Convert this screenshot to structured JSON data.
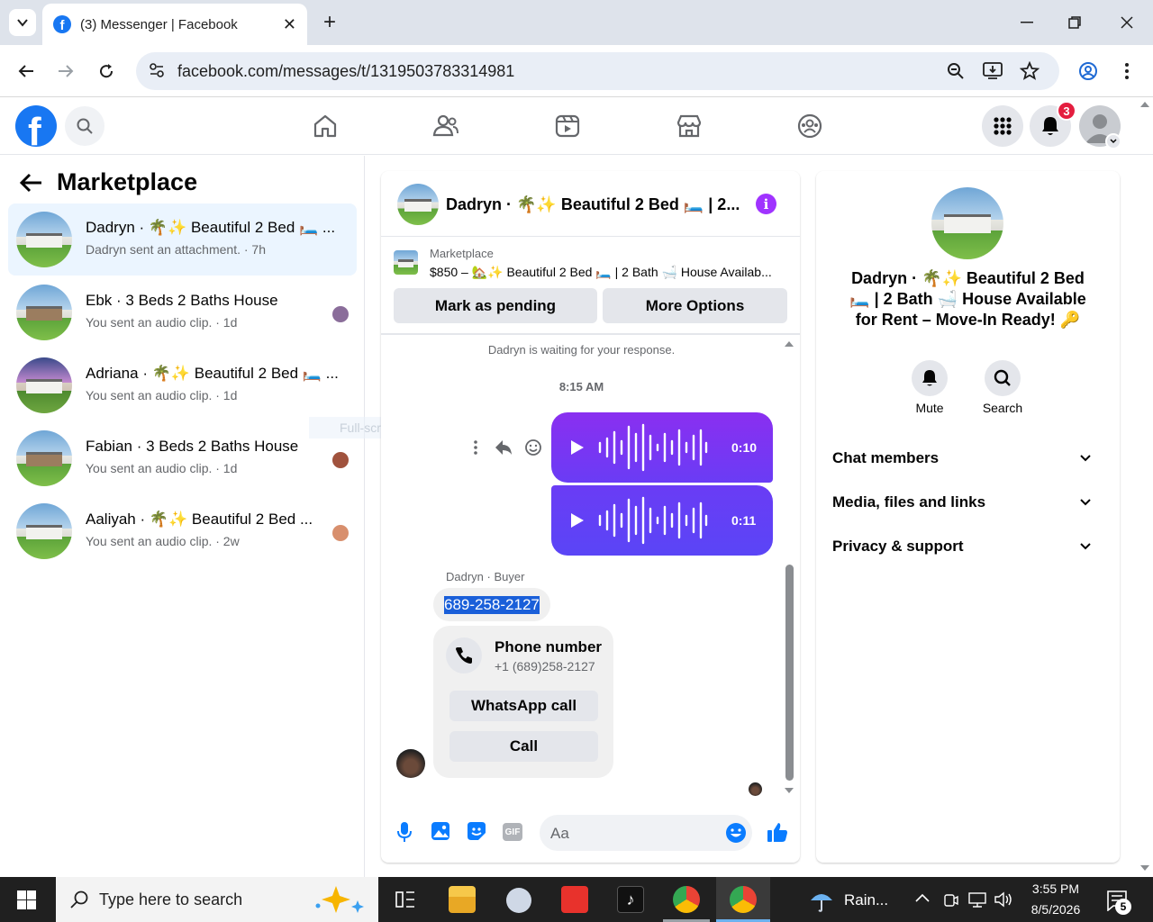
{
  "browser": {
    "tab_title": "(3) Messenger | Facebook",
    "url": "facebook.com/messages/t/1319503783314981",
    "new_tab_symbol": "+"
  },
  "fb": {
    "notification_count": "3",
    "brand_color": "#1877f2"
  },
  "left": {
    "title": "Marketplace",
    "conversations": [
      {
        "name": "Dadryn · 🌴✨ Beautiful 2 Bed 🛏️ ...",
        "preview": "Dadryn sent an attachment. · 7h",
        "active": true
      },
      {
        "name": "Ebk · 3 Beds 2 Baths House",
        "preview": "You sent an audio clip. · 1d"
      },
      {
        "name": "Adriana · 🌴✨ Beautiful 2 Bed 🛏️ ...",
        "preview": "You sent an audio clip. · 1d"
      },
      {
        "name": "Fabian · 3 Beds 2 Baths House",
        "preview": "You sent an audio clip. · 1d"
      },
      {
        "name": "Aaliyah · 🌴✨ Beautiful 2 Bed ...",
        "preview": "You sent an audio clip. · 2w"
      }
    ],
    "snip_overlay": "Full-screen Snip"
  },
  "chat": {
    "header_title": "Dadryn · 🌴✨ Beautiful 2 Bed 🛏️ | 2...",
    "listing_label": "Marketplace",
    "listing_text": "$850 – 🏡✨ Beautiful 2 Bed 🛏️ | 2 Bath 🛁 House Availab...",
    "mark_pending": "Mark as pending",
    "more_options": "More Options",
    "waiting": "Dadryn is waiting for your response.",
    "time": "8:15 AM",
    "audio1_duration": "0:10",
    "audio2_duration": "0:11",
    "sender_label": "Dadryn · Buyer",
    "phone_bubble": "689-258-2127",
    "phone_card_title": "Phone number",
    "phone_card_number": "+1 (689)258-2127",
    "whatsapp_call": "WhatsApp call",
    "call": "Call",
    "compose_placeholder": "Aa",
    "accent": "#0a7cff",
    "bubble_color": "#7b32f3"
  },
  "right": {
    "title": "Dadryn · 🌴✨ Beautiful 2 Bed 🛏️ | 2 Bath 🛁 House Available for Rent – Move-In Ready! 🔑",
    "mute": "Mute",
    "search": "Search",
    "sections": [
      "Chat members",
      "Media, files and links",
      "Privacy & support"
    ]
  },
  "taskbar": {
    "search_placeholder": "Type here to search",
    "weather": "Rain...",
    "time": "3:55 PM",
    "date": "8/5/2026",
    "notif_count": "5"
  }
}
